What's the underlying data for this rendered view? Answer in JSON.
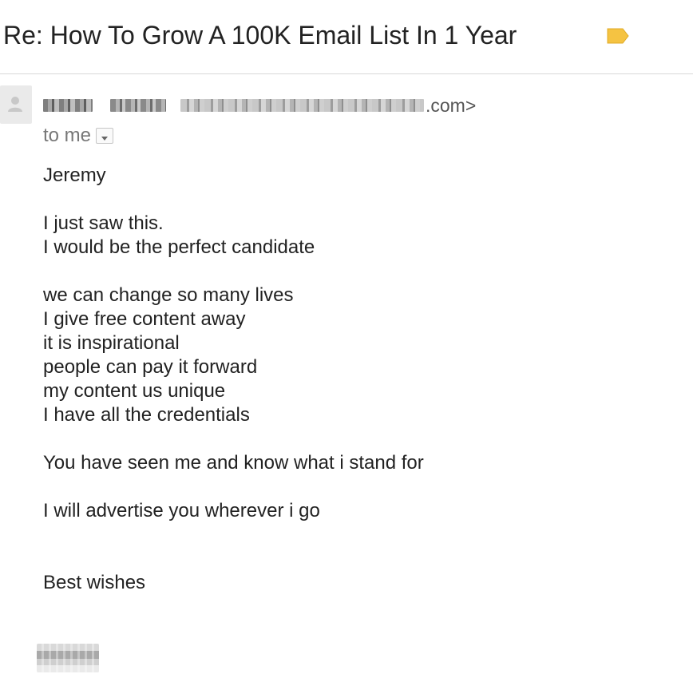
{
  "email": {
    "subject": "Re: How To Grow A 100K Email List In 1 Year",
    "label_tag_icon": "label-tag-icon",
    "sender": {
      "avatar_icon": "person-icon",
      "address_suffix": ".com>"
    },
    "recipient": {
      "text": "to me",
      "details_icon": "dropdown-arrow-icon"
    },
    "body": {
      "greeting": "Jeremy",
      "p1": [
        "I just saw this.",
        "I would be the perfect candidate"
      ],
      "p2": [
        "we can change so many lives",
        "I give free content away",
        "it is inspirational",
        "people can pay it forward",
        "my content us unique",
        "I have all the credentials"
      ],
      "p3": "You have seen me and know what i stand for",
      "p4": "I will advertise you wherever i go",
      "closing": "Best wishes"
    }
  },
  "colors": {
    "label_tag": "#f5c342",
    "text": "#222222",
    "muted": "#777777",
    "divider": "#d8d8d8"
  }
}
